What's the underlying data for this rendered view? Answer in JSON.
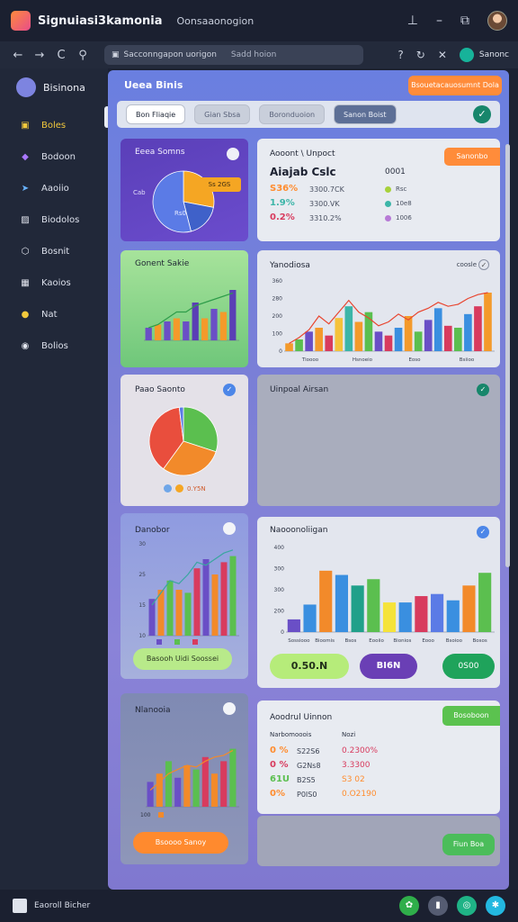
{
  "window": {
    "title": "Signuiasi3kamonia",
    "subtitle": "Oonsaaonogion"
  },
  "addressbar": {
    "url": "Sacconngapon uorigon",
    "url_secondary": "Sadd hoion",
    "extension_label": "Sanonc"
  },
  "sidebar": {
    "brand": "Bisinona",
    "items": [
      {
        "label": "Boles",
        "icon": "square-icon",
        "color": "#f3c93c",
        "active": true
      },
      {
        "label": "Bodoon",
        "icon": "diamond-icon",
        "color": "#a978ff"
      },
      {
        "label": "Aaoiio",
        "icon": "send-icon",
        "color": "#69b4ff"
      },
      {
        "label": "Biodolos",
        "icon": "image-icon",
        "color": "#e3e6ef"
      },
      {
        "label": "Bosnit",
        "icon": "shield-icon",
        "color": "#e3e6ef"
      },
      {
        "label": "Kaoios",
        "icon": "grid-icon",
        "color": "#e3e6ef"
      },
      {
        "label": "Nat",
        "icon": "circle-icon",
        "color": "#f3c93c"
      },
      {
        "label": "Bolios",
        "icon": "chat-icon",
        "color": "#e3e6ef"
      }
    ]
  },
  "main": {
    "title": "Ueea Binis",
    "cta": "Bsouetacauosumnt Dola",
    "tabs": [
      "Bon Fliaqie",
      "Gian Sbsa",
      "Boronduoion",
      "Sanon Boist"
    ]
  },
  "pie_card": {
    "title": "Eeea Somns",
    "callout": "Ss 2GS",
    "side_label": "Cab",
    "inner_label": "Rs0"
  },
  "stat_card": {
    "title": "Aooont \\ Unpoct",
    "badge": "Sanonbo",
    "headline": "Aiajab Cslc",
    "headline_value": "0001",
    "rows": [
      {
        "pct": "S36%",
        "val": "3300.7CK",
        "legend": "Rsc",
        "color": "#ff8c2e",
        "dot": "#a7d13b"
      },
      {
        "pct": "1.9%",
        "val": "3300.VK",
        "legend": "10e8",
        "color": "#3cb5a8",
        "dot": "#3cb5a8"
      },
      {
        "pct": "0.2%",
        "val": "3310.2%",
        "legend": "1006",
        "color": "#d83b5e",
        "dot": "#b77ad6"
      }
    ]
  },
  "green_chart_card": {
    "title": "Gonent Sakie"
  },
  "line_bar_card": {
    "title": "Yanodiosa",
    "right_label": "coosle",
    "yticks": [
      "360",
      "280",
      "200",
      "100",
      "0"
    ],
    "xlabels": [
      "Tioooo",
      "Hsnoeio",
      "Eoso",
      "Bsiioo"
    ]
  },
  "pie2_card": {
    "title": "Paao Saonto",
    "legend": "0.Y5N"
  },
  "empty_card": {
    "title": "Uinpoal Airsan"
  },
  "bar3_card": {
    "title": "Danobor",
    "yticks": [
      "30",
      "25",
      "15",
      "10"
    ]
  },
  "bar4_card": {
    "title": "Naooonoliigan",
    "yticks": [
      "400",
      "300",
      "300",
      "200",
      "0"
    ],
    "xlabels": [
      "Sossiooo",
      "Bioomis",
      "Bsos",
      "Eooiio",
      "Bionios",
      "Eooo",
      "Bsoioo",
      "Bosos"
    ]
  },
  "pill_row": {
    "green": "0.50.N",
    "purple": "BI6N",
    "green2": "0S00"
  },
  "button_green_light": "Basooh Uidi Soossei",
  "bar5_card": {
    "title": "Nlanooia",
    "ytick": "100"
  },
  "button_orange": "Bsoooo Sanoy",
  "report_card": {
    "title": "Aoodrul Uinnon",
    "badge": "Bosoboon",
    "col1_header": "Narbomooois",
    "col2_header": "Nozi",
    "rows": [
      {
        "pct": "0 %",
        "a": "S22S6",
        "b": "0.2300%",
        "color": "#ff8c2e",
        "bcolor": "#d83b5e"
      },
      {
        "pct": "0 %",
        "a": "G2Ns8",
        "b": "3.3300",
        "color": "#d83b5e",
        "bcolor": "#d83b5e"
      },
      {
        "pct": "61U",
        "a": "B2S5",
        "b": "S3 02",
        "color": "#5bbf4f",
        "bcolor": "#ff8c2e"
      },
      {
        "pct": "0%",
        "a": "P0IS0",
        "b": "0.O2190",
        "color": "#ff8c2e",
        "bcolor": "#ff8c2e"
      }
    ]
  },
  "bottom_button": "Fiun Boa",
  "footer": {
    "label": "Eaoroll Bicher"
  },
  "chart_data": [
    {
      "type": "pie",
      "values": [
        28,
        18,
        54
      ],
      "colors": [
        "#f5a623",
        "#3f61c9",
        "#5b7be6"
      ]
    },
    {
      "type": "bar",
      "categories": [
        "1",
        "2",
        "3",
        "4",
        "5",
        "6",
        "7",
        "8",
        "9",
        "10"
      ],
      "values": [
        20,
        25,
        30,
        35,
        30,
        60,
        35,
        50,
        45,
        80
      ],
      "colors": [
        "#6a4fc6",
        "#f49a2b",
        "#6a4fc6",
        "#f49a2b",
        "#6a4fc6",
        "#5a3fb5",
        "#f49a2b",
        "#6a4fc6",
        "#f49a2b",
        "#5a3fb5"
      ],
      "line": [
        20,
        25,
        35,
        45,
        45,
        55,
        60,
        65,
        70,
        75
      ],
      "ylim": [
        0,
        100
      ]
    },
    {
      "type": "bar",
      "yticks": [
        "360",
        "280",
        "200",
        "100",
        "0"
      ],
      "categories": [
        "Tioooo",
        "Hsnoeio",
        "Eoso",
        "Bsiioo"
      ],
      "values": [
        40,
        60,
        100,
        120,
        80,
        170,
        230,
        150,
        200,
        100,
        80,
        120,
        180,
        100,
        160,
        220,
        130,
        120,
        190,
        230,
        300
      ],
      "colors": [
        "#f49a2b",
        "#5bbf4f",
        "#6a4fc6",
        "#f49a2b",
        "#d83b5e",
        "#f5c23a",
        "#3cb5a8",
        "#f49a2b",
        "#5bbf4f",
        "#6a4fc6",
        "#d83b5e",
        "#3a8fe0",
        "#f49a2b",
        "#5bbf4f",
        "#6a4fc6",
        "#3a8fe0",
        "#d83b5e",
        "#5bbf4f",
        "#3a8fe0",
        "#d83b5e",
        "#f49a2b"
      ],
      "line": [
        40,
        70,
        110,
        180,
        140,
        200,
        260,
        200,
        170,
        130,
        150,
        190,
        160,
        200,
        220,
        250,
        230,
        240,
        270,
        290,
        300
      ],
      "ylim": [
        0,
        360
      ]
    },
    {
      "type": "pie",
      "values": [
        30,
        30,
        38,
        2
      ],
      "colors": [
        "#5bbf4f",
        "#f28a2a",
        "#e94e3d",
        "#5b7be6"
      ]
    },
    {
      "type": "bar",
      "yticks": [
        "30",
        "25",
        "15",
        "10"
      ],
      "values": [
        12,
        15,
        18,
        15,
        14,
        22,
        25,
        20,
        24,
        26
      ],
      "colors": [
        "#6a4fc6",
        "#f28a2a",
        "#5bbf4f",
        "#f28a2a",
        "#5bbf4f",
        "#d83b5e",
        "#6a4fc6",
        "#f28a2a",
        "#d83b5e",
        "#5bbf4f"
      ],
      "line": [
        10,
        14,
        18,
        17,
        20,
        24,
        23,
        25,
        27,
        28
      ],
      "ylim": [
        0,
        30
      ]
    },
    {
      "type": "bar",
      "yticks": [
        "400",
        "300",
        "300",
        "200",
        "0"
      ],
      "categories": [
        "Sossiooo",
        "Bioomis",
        "Bsos",
        "Eooiio",
        "Bionios",
        "Eooo",
        "Bsoioo",
        "Bosos"
      ],
      "values": [
        60,
        130,
        290,
        270,
        220,
        250,
        140,
        140,
        170,
        180,
        150,
        220,
        280
      ],
      "colors": [
        "#6a4fc6",
        "#3a8fe0",
        "#f28a2a",
        "#3a8fe0",
        "#20a08a",
        "#5bbf4f",
        "#f5e33a",
        "#3a8fe0",
        "#d83b5e",
        "#5b7be6",
        "#3a8fe0",
        "#f28a2a",
        "#5bbf4f"
      ],
      "ylim": [
        0,
        400
      ]
    },
    {
      "type": "bar",
      "values": [
        30,
        40,
        55,
        35,
        50,
        45,
        60,
        40,
        55,
        70
      ],
      "colors": [
        "#6a4fc6",
        "#f28a2a",
        "#5bbf4f",
        "#6a4fc6",
        "#f28a2a",
        "#5bbf4f",
        "#d83b5e",
        "#f28a2a",
        "#d83b5e",
        "#5bbf4f"
      ],
      "line": [
        20,
        30,
        40,
        45,
        50,
        48,
        55,
        60,
        62,
        68
      ],
      "ylim": [
        0,
        100
      ]
    }
  ]
}
